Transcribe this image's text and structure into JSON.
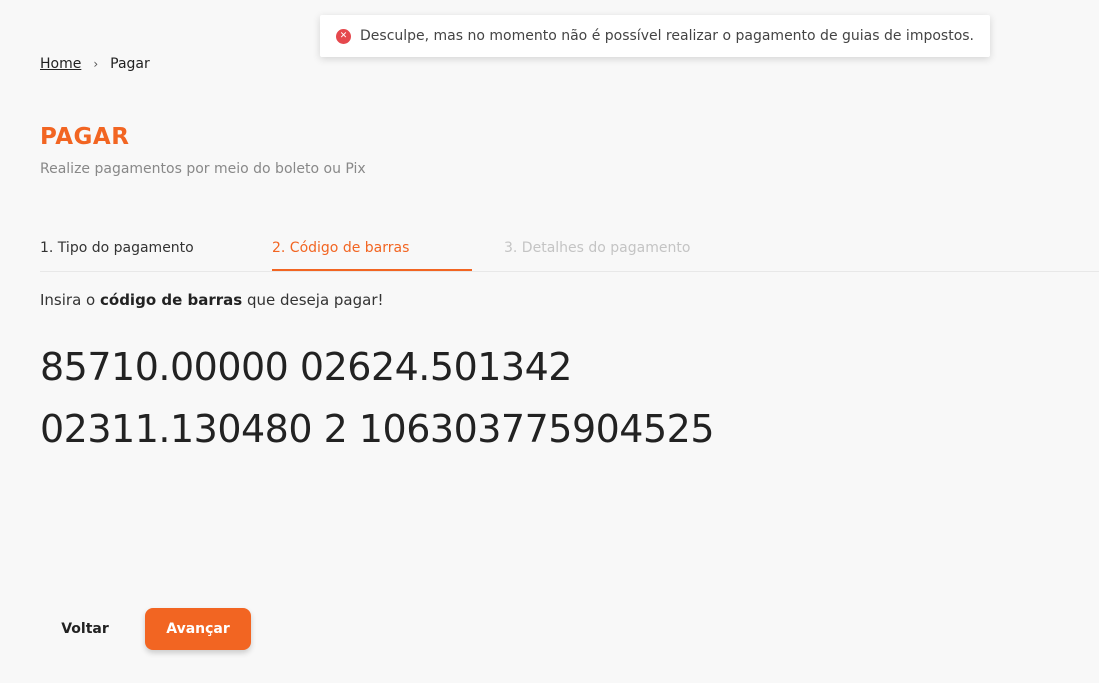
{
  "toast": {
    "icon": "error-icon",
    "message": "Desculpe, mas no momento não é possível realizar o pagamento de guias de impostos.",
    "color": "#e5484d"
  },
  "breadcrumb": {
    "home": "Home",
    "separator": "›",
    "current": "Pagar"
  },
  "header": {
    "title": "PAGAR",
    "subtitle": "Realize pagamentos por meio do boleto ou Pix"
  },
  "steps": [
    {
      "label": "1. Tipo do pagamento",
      "state": "done"
    },
    {
      "label": "2. Código de barras",
      "state": "active"
    },
    {
      "label": "3. Detalhes do pagamento",
      "state": "pending"
    }
  ],
  "instruction": {
    "prefix": "Insira o ",
    "bold": "código de barras",
    "suffix": " que deseja pagar!"
  },
  "barcode": {
    "line1": "85710.00000 02624.501342",
    "line2": "02311.130480 2 106303775904525"
  },
  "actions": {
    "back_label": "Voltar",
    "next_label": "Avançar"
  },
  "colors": {
    "accent": "#f26522",
    "error": "#e5484d",
    "background": "#f8f8f8"
  }
}
